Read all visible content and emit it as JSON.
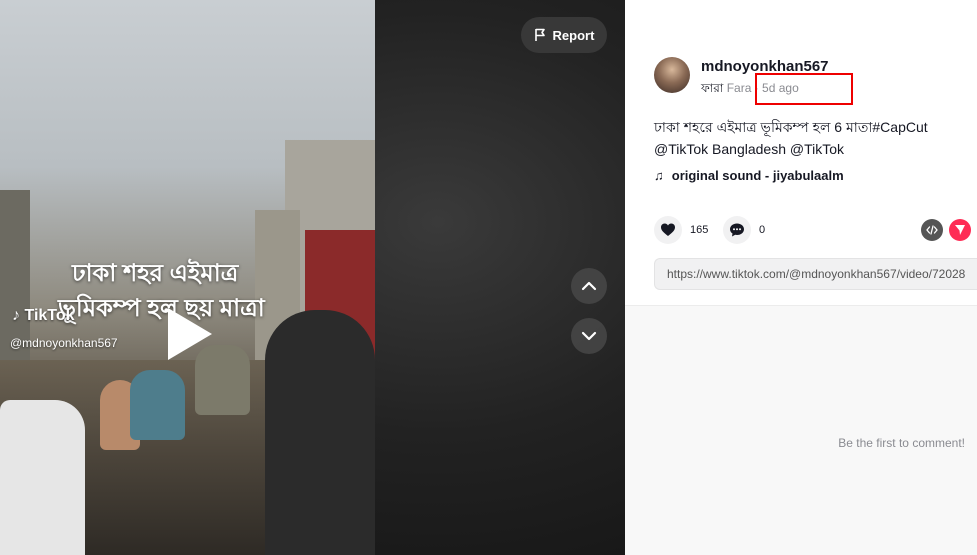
{
  "video": {
    "overlay_line1": "ঢাকা শহর এইমাত্র",
    "overlay_line2": "ভূমিকম্প হল ছয় মাত্রা",
    "watermark_logo": "TikTok",
    "watermark_user": "@mdnoyonkhan567"
  },
  "controls": {
    "report_label": "Report"
  },
  "author": {
    "username": "mdnoyonkhan567",
    "nickname_bn": "ফারা",
    "nickname_en": "Fara",
    "separator": " · ",
    "posted": "5d ago"
  },
  "caption": {
    "text": "ঢাকা শহরে এইমাত্র ভূমিকম্প হল 6 মাতা",
    "hashtag": "#CapCut",
    "mention1": "@TikTok Bangladesh",
    "mention2": "@TikTok"
  },
  "sound": {
    "label": "original sound - jiyabulaalm"
  },
  "stats": {
    "likes": "165",
    "comments": "0"
  },
  "link": {
    "url": "https://www.tiktok.com/@mdnoyonkhan567/video/72028"
  },
  "comments_section": {
    "empty_text": "Be the first to comment!"
  },
  "colors": {
    "accent": "#fe2c55",
    "highlight": "#ee0000"
  }
}
